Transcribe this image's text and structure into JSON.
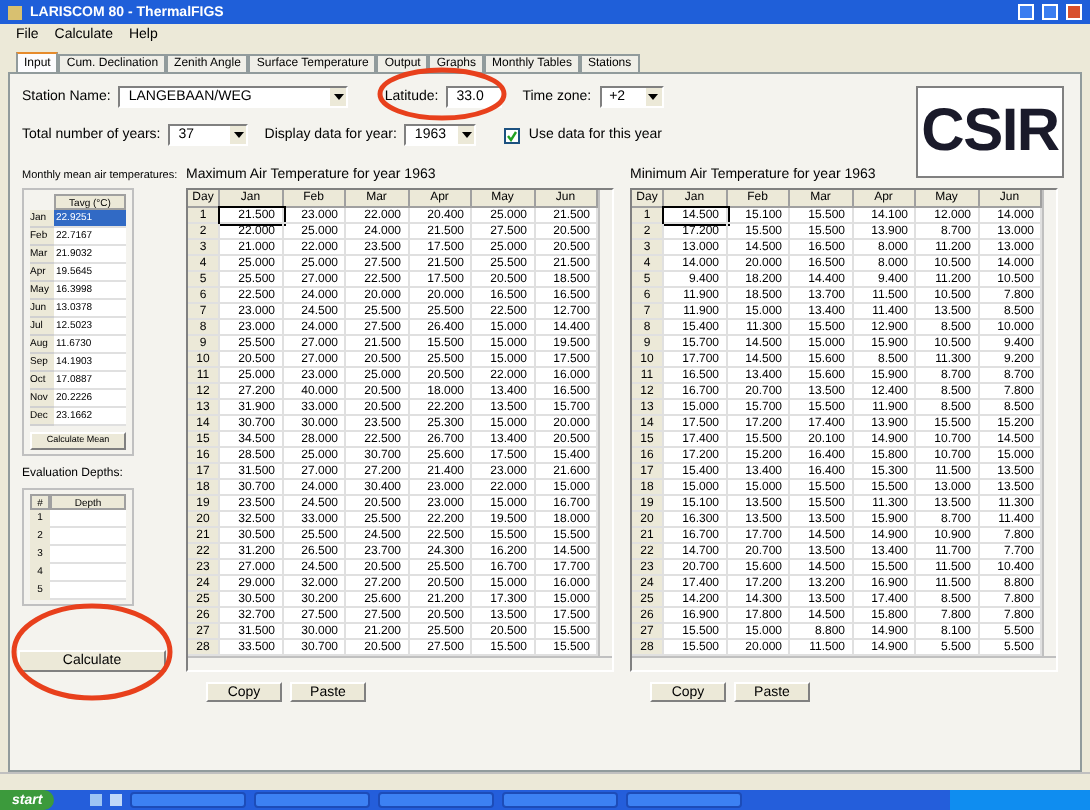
{
  "window": {
    "title": "LARISCOM 80 - ThermalFIGS"
  },
  "menu": [
    "File",
    "Calculate",
    "Help"
  ],
  "tabs": [
    {
      "label": "Input",
      "selected": true
    },
    {
      "label": "Cum. Declination",
      "selected": false
    },
    {
      "label": "Zenith Angle",
      "selected": false
    },
    {
      "label": "Surface Temperature",
      "selected": false
    },
    {
      "label": "Output",
      "selected": false
    },
    {
      "label": "Graphs",
      "selected": false
    },
    {
      "label": "Monthly Tables",
      "selected": false
    },
    {
      "label": "Stations",
      "selected": false
    }
  ],
  "station": {
    "label": "Station Name:",
    "value": "LANGEBAAN/WEG"
  },
  "latitude": {
    "label": "Latitude:",
    "value": "33.0"
  },
  "time_zone": {
    "label": "Time zone:",
    "value": "+2"
  },
  "years": {
    "label": "Total number of years:",
    "value": "37"
  },
  "year": {
    "label": "Display data for year:",
    "value": "1963"
  },
  "use_year": {
    "label": "Use data for this year",
    "checked": true
  },
  "logo": {
    "text": "CSIR"
  },
  "monthly": {
    "title": "Monthly mean air temperatures:",
    "column": "Tavg (°C)",
    "button": "Calculate Mean",
    "rows": [
      {
        "month": "Jan",
        "value": "22.9251",
        "selected": true
      },
      {
        "month": "Feb",
        "value": "22.7167",
        "selected": false
      },
      {
        "month": "Mar",
        "value": "21.9032",
        "selected": false
      },
      {
        "month": "Apr",
        "value": "19.5645",
        "selected": false
      },
      {
        "month": "May",
        "value": "16.3998",
        "selected": false
      },
      {
        "month": "Jun",
        "value": "13.0378",
        "selected": false
      },
      {
        "month": "Jul",
        "value": "12.5023",
        "selected": false
      },
      {
        "month": "Aug",
        "value": "11.6730",
        "selected": false
      },
      {
        "month": "Sep",
        "value": "14.1903",
        "selected": false
      },
      {
        "month": "Oct",
        "value": "17.0887",
        "selected": false
      },
      {
        "month": "Nov",
        "value": "20.2226",
        "selected": false
      },
      {
        "month": "Dec",
        "value": "23.1662",
        "selected": false
      }
    ]
  },
  "depths": {
    "title": "Evaluation Depths:",
    "columns": [
      "#",
      "Depth"
    ],
    "rows": [
      "1",
      "2",
      "3",
      "4",
      "5"
    ]
  },
  "calculate_button": "Calculate",
  "tables": [
    {
      "title": "Maximum Air Temperature for year 1963",
      "columns": [
        "Day",
        "Jan",
        "Feb",
        "Mar",
        "Apr",
        "May",
        "Jun"
      ],
      "buttons": [
        "Copy",
        "Paste"
      ],
      "rows": [
        [
          "1",
          "21.500",
          "23.000",
          "22.000",
          "20.400",
          "25.000",
          "21.500"
        ],
        [
          "2",
          "22.000",
          "25.000",
          "24.000",
          "21.500",
          "27.500",
          "20.500"
        ],
        [
          "3",
          "21.000",
          "22.000",
          "23.500",
          "17.500",
          "25.000",
          "20.500"
        ],
        [
          "4",
          "25.000",
          "25.000",
          "27.500",
          "21.500",
          "25.500",
          "21.500"
        ],
        [
          "5",
          "25.500",
          "27.000",
          "22.500",
          "17.500",
          "20.500",
          "18.500"
        ],
        [
          "6",
          "22.500",
          "24.000",
          "20.000",
          "20.000",
          "16.500",
          "16.500"
        ],
        [
          "7",
          "23.000",
          "24.500",
          "25.500",
          "25.500",
          "22.500",
          "12.700"
        ],
        [
          "8",
          "23.000",
          "24.000",
          "27.500",
          "26.400",
          "15.000",
          "14.400"
        ],
        [
          "9",
          "25.500",
          "27.000",
          "21.500",
          "15.500",
          "15.000",
          "19.500"
        ],
        [
          "10",
          "20.500",
          "27.000",
          "20.500",
          "25.500",
          "15.000",
          "17.500"
        ],
        [
          "11",
          "25.000",
          "23.000",
          "25.000",
          "20.500",
          "22.000",
          "16.000"
        ],
        [
          "12",
          "27.200",
          "40.000",
          "20.500",
          "18.000",
          "13.400",
          "16.500"
        ],
        [
          "13",
          "31.900",
          "33.000",
          "20.500",
          "22.200",
          "13.500",
          "15.700"
        ],
        [
          "14",
          "30.700",
          "30.000",
          "23.500",
          "25.300",
          "15.000",
          "20.000"
        ],
        [
          "15",
          "34.500",
          "28.000",
          "22.500",
          "26.700",
          "13.400",
          "20.500"
        ],
        [
          "16",
          "28.500",
          "25.000",
          "30.700",
          "25.600",
          "17.500",
          "15.400"
        ],
        [
          "17",
          "31.500",
          "27.000",
          "27.200",
          "21.400",
          "23.000",
          "21.600"
        ],
        [
          "18",
          "30.700",
          "24.000",
          "30.400",
          "23.000",
          "22.000",
          "15.000"
        ],
        [
          "19",
          "23.500",
          "24.500",
          "20.500",
          "23.000",
          "15.000",
          "16.700"
        ],
        [
          "20",
          "32.500",
          "33.000",
          "25.500",
          "22.200",
          "19.500",
          "18.000"
        ],
        [
          "21",
          "30.500",
          "25.500",
          "24.500",
          "22.500",
          "15.500",
          "15.500"
        ],
        [
          "22",
          "31.200",
          "26.500",
          "23.700",
          "24.300",
          "16.200",
          "14.500"
        ],
        [
          "23",
          "27.000",
          "24.500",
          "20.500",
          "25.500",
          "16.700",
          "17.700"
        ],
        [
          "24",
          "29.000",
          "32.000",
          "27.200",
          "20.500",
          "15.000",
          "16.000"
        ],
        [
          "25",
          "30.500",
          "30.200",
          "25.600",
          "21.200",
          "17.300",
          "15.000"
        ],
        [
          "26",
          "32.700",
          "27.500",
          "27.500",
          "20.500",
          "13.500",
          "17.500"
        ],
        [
          "27",
          "31.500",
          "30.000",
          "21.200",
          "25.500",
          "20.500",
          "15.500"
        ],
        [
          "28",
          "33.500",
          "30.700",
          "20.500",
          "27.500",
          "15.500",
          "15.500"
        ]
      ]
    },
    {
      "title": "Minimum Air Temperature for year 1963",
      "columns": [
        "Day",
        "Jan",
        "Feb",
        "Mar",
        "Apr",
        "May",
        "Jun"
      ],
      "buttons": [
        "Copy",
        "Paste"
      ],
      "rows": [
        [
          "1",
          "14.500",
          "15.100",
          "15.500",
          "14.100",
          "12.000",
          "14.000"
        ],
        [
          "2",
          "17.200",
          "15.500",
          "15.500",
          "13.900",
          "8.700",
          "13.000"
        ],
        [
          "3",
          "13.000",
          "14.500",
          "16.500",
          "8.000",
          "11.200",
          "13.000"
        ],
        [
          "4",
          "14.000",
          "20.000",
          "16.500",
          "8.000",
          "10.500",
          "14.000"
        ],
        [
          "5",
          "9.400",
          "18.200",
          "14.400",
          "9.400",
          "11.200",
          "10.500"
        ],
        [
          "6",
          "11.900",
          "18.500",
          "13.700",
          "11.500",
          "10.500",
          "7.800"
        ],
        [
          "7",
          "11.900",
          "15.000",
          "13.400",
          "11.400",
          "13.500",
          "8.500"
        ],
        [
          "8",
          "15.400",
          "11.300",
          "15.500",
          "12.900",
          "8.500",
          "10.000"
        ],
        [
          "9",
          "15.700",
          "14.500",
          "15.000",
          "15.900",
          "10.500",
          "9.400"
        ],
        [
          "10",
          "17.700",
          "14.500",
          "15.600",
          "8.500",
          "11.300",
          "9.200"
        ],
        [
          "11",
          "16.500",
          "13.400",
          "15.600",
          "15.900",
          "8.700",
          "8.700"
        ],
        [
          "12",
          "16.700",
          "20.700",
          "13.500",
          "12.400",
          "8.500",
          "7.800"
        ],
        [
          "13",
          "15.000",
          "15.700",
          "15.500",
          "11.900",
          "8.500",
          "8.500"
        ],
        [
          "14",
          "17.500",
          "17.200",
          "17.400",
          "13.900",
          "15.500",
          "15.200"
        ],
        [
          "15",
          "17.400",
          "15.500",
          "20.100",
          "14.900",
          "10.700",
          "14.500"
        ],
        [
          "16",
          "17.200",
          "15.200",
          "16.400",
          "15.800",
          "10.700",
          "15.000"
        ],
        [
          "17",
          "15.400",
          "13.400",
          "16.400",
          "15.300",
          "11.500",
          "13.500"
        ],
        [
          "18",
          "15.000",
          "15.000",
          "15.500",
          "15.500",
          "13.000",
          "13.500"
        ],
        [
          "19",
          "15.100",
          "13.500",
          "15.500",
          "11.300",
          "13.500",
          "11.300"
        ],
        [
          "20",
          "16.300",
          "13.500",
          "13.500",
          "15.900",
          "8.700",
          "11.400"
        ],
        [
          "21",
          "16.700",
          "17.700",
          "14.500",
          "14.900",
          "10.900",
          "7.800"
        ],
        [
          "22",
          "14.700",
          "20.700",
          "13.500",
          "13.400",
          "11.700",
          "7.700"
        ],
        [
          "23",
          "20.700",
          "15.600",
          "14.500",
          "15.500",
          "11.500",
          "10.400"
        ],
        [
          "24",
          "17.400",
          "17.200",
          "13.200",
          "16.900",
          "11.500",
          "8.800"
        ],
        [
          "25",
          "14.200",
          "14.300",
          "13.500",
          "17.400",
          "8.500",
          "7.800"
        ],
        [
          "26",
          "16.900",
          "17.800",
          "14.500",
          "15.800",
          "7.800",
          "7.800"
        ],
        [
          "27",
          "15.500",
          "15.000",
          "8.800",
          "14.900",
          "8.100",
          "5.500"
        ],
        [
          "28",
          "15.500",
          "20.000",
          "11.500",
          "14.900",
          "5.500",
          "5.500"
        ]
      ]
    }
  ],
  "taskbar": {
    "start": "start"
  }
}
